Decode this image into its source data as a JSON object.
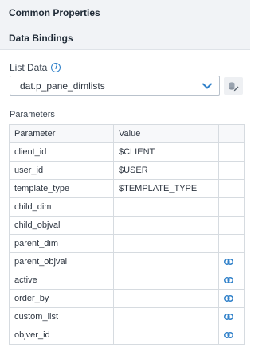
{
  "sections": {
    "common_properties": "Common Properties",
    "data_bindings": "Data Bindings"
  },
  "list_data": {
    "label": "List Data",
    "info_icon_glyph": "i",
    "selected": "dat.p_pane_dimlists"
  },
  "parameters": {
    "label": "Parameters",
    "headers": [
      "Parameter",
      "Value",
      ""
    ],
    "rows": [
      {
        "name": "client_id",
        "value": "$CLIENT",
        "linkable": false
      },
      {
        "name": "user_id",
        "value": "$USER",
        "linkable": false
      },
      {
        "name": "template_type",
        "value": "$TEMPLATE_TYPE",
        "linkable": false
      },
      {
        "name": "child_dim",
        "value": "",
        "linkable": false
      },
      {
        "name": "child_objval",
        "value": "",
        "linkable": false
      },
      {
        "name": "parent_dim",
        "value": "",
        "linkable": false
      },
      {
        "name": "parent_objval",
        "value": "",
        "linkable": true
      },
      {
        "name": "active",
        "value": "",
        "linkable": true
      },
      {
        "name": "order_by",
        "value": "",
        "linkable": true
      },
      {
        "name": "custom_list",
        "value": "",
        "linkable": true
      },
      {
        "name": "objver_id",
        "value": "",
        "linkable": true
      }
    ]
  },
  "colors": {
    "accent": "#2f80c9",
    "header_bg": "#f1f3f6",
    "border": "#d6dbe0"
  }
}
